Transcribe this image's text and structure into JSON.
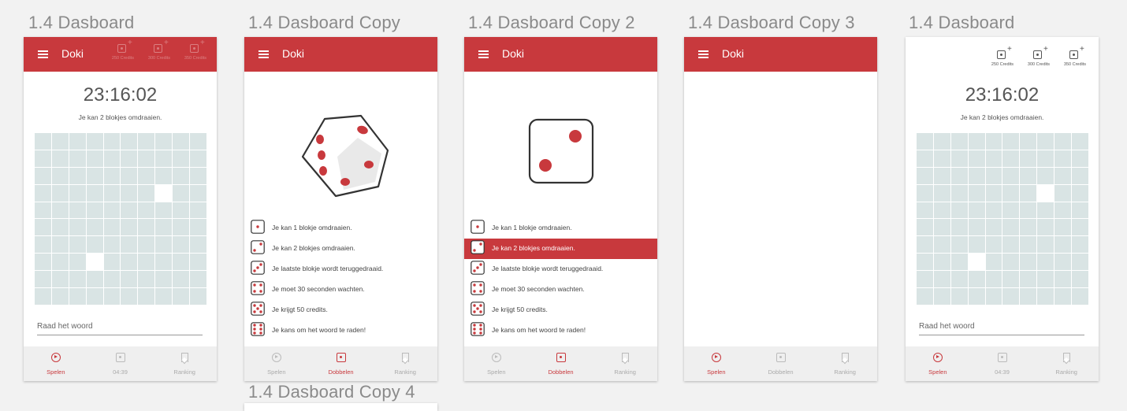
{
  "artboards": [
    {
      "title": "1.4 Dasboard"
    },
    {
      "title": "1.4 Dasboard Copy"
    },
    {
      "title": "1.4 Dasboard Copy 2"
    },
    {
      "title": "1.4 Dasboard Copy 3"
    },
    {
      "title": "1.4 Dasboard"
    },
    {
      "title": "1.4 Dasboard Copy 4"
    }
  ],
  "app": {
    "title": "Doki"
  },
  "credits": [
    {
      "label": "250 Credits",
      "icon": "dice-plus-icon"
    },
    {
      "label": "300 Credits",
      "icon": "dice-plus-icon"
    },
    {
      "label": "350 Credits",
      "icon": "dice-plus-icon"
    }
  ],
  "play": {
    "timer": "23:16:02",
    "message": "Je kan 2 blokjes omdraaien.",
    "grid_size": 10,
    "open_cells": [
      [
        3,
        7
      ],
      [
        7,
        3
      ]
    ],
    "guess_placeholder": "Raad het woord"
  },
  "nav": [
    {
      "label": "Spelen",
      "icon": "play-circle-icon"
    },
    {
      "label": "04:39",
      "icon": "dice-icon"
    },
    {
      "label": "Dobbelen",
      "icon": "dice-icon"
    },
    {
      "label": "Ranking",
      "icon": "bookmark-icon"
    }
  ],
  "dice_rules": [
    {
      "pips": 1,
      "text": "Je kan 1 blokje omdraaien."
    },
    {
      "pips": 2,
      "text": "Je kan 2 blokjes omdraaien."
    },
    {
      "pips": 3,
      "text": "Je laatste blokje wordt teruggedraaid."
    },
    {
      "pips": 4,
      "text": "Je moet 30 seconden wachten."
    },
    {
      "pips": 5,
      "text": "Je krijgt 50 credits."
    },
    {
      "pips": 6,
      "text": "Je kans om het woord te raden!"
    }
  ],
  "colors": {
    "primary": "#c8393d",
    "grid_cell": "#d9e4e4",
    "nav_bg": "#efefef",
    "muted": "#aaaaaa"
  }
}
